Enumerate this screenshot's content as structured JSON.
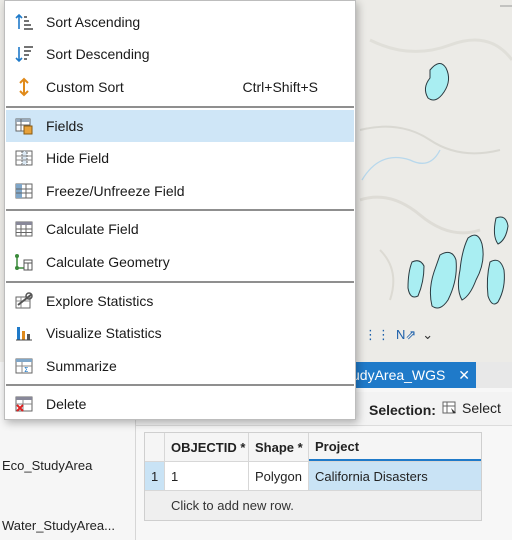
{
  "menu": {
    "items": [
      {
        "label": "Sort Ascending",
        "icon": "sort-ascending-icon"
      },
      {
        "label": "Sort Descending",
        "icon": "sort-descending-icon"
      },
      {
        "label": "Custom Sort",
        "shortcut": "Ctrl+Shift+S",
        "icon": "custom-sort-icon"
      },
      {
        "label": "Fields",
        "icon": "fields-icon",
        "highlighted": true
      },
      {
        "label": "Hide Field",
        "icon": "hide-field-icon"
      },
      {
        "label": "Freeze/Unfreeze Field",
        "icon": "freeze-field-icon"
      },
      {
        "label": "Calculate Field",
        "icon": "calculate-field-icon"
      },
      {
        "label": "Calculate Geometry",
        "icon": "calculate-geometry-icon"
      },
      {
        "label": "Explore Statistics",
        "icon": "explore-statistics-icon"
      },
      {
        "label": "Visualize Statistics",
        "icon": "visualize-statistics-icon"
      },
      {
        "label": "Summarize",
        "icon": "summarize-icon"
      },
      {
        "label": "Delete",
        "icon": "delete-icon"
      }
    ]
  },
  "contents": {
    "layers": [
      "Eco_StudyArea",
      "Water_StudyArea..."
    ]
  },
  "table": {
    "tab_label": "udyArea_WGS",
    "selection_label": "Selection:",
    "select_button": "Select",
    "columns": [
      "OBJECTID *",
      "Shape *",
      "Project"
    ],
    "rows": [
      {
        "rownum": "1",
        "objectid": "1",
        "shape": "Polygon",
        "project": "California Disasters"
      }
    ],
    "add_row": "Click to add new row."
  },
  "colors": {
    "accent": "#1f7ac9",
    "highlight": "#cfe6f7",
    "water": "#a9eef2"
  }
}
